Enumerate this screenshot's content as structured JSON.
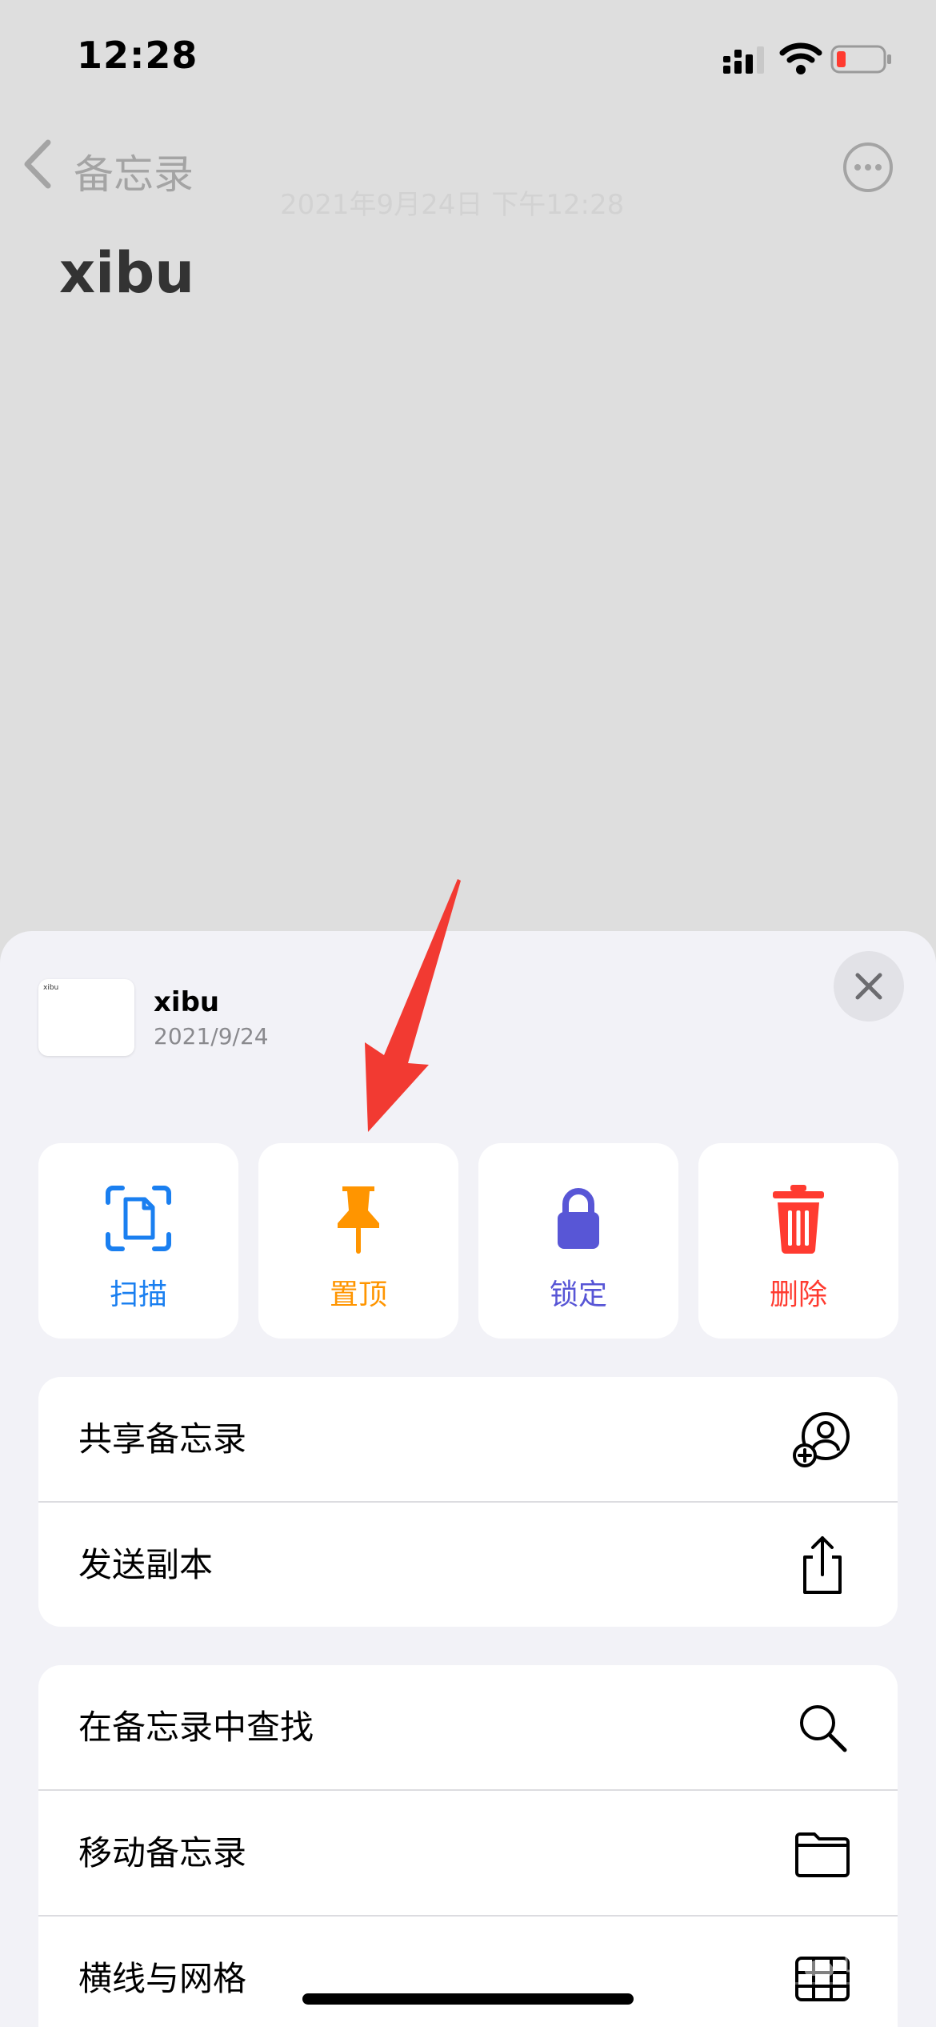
{
  "status_bar": {
    "time": "12:28"
  },
  "nav": {
    "back_label": "备忘录",
    "faded_date": "2021年9月24日 下午12:28"
  },
  "note": {
    "title": "xibu"
  },
  "sheet": {
    "thumb_text": "xibu",
    "title": "xibu",
    "date": "2021/9/24"
  },
  "actions": [
    {
      "label": "扫描",
      "icon": "scan-document-icon",
      "color": "#1a7ff0"
    },
    {
      "label": "置顶",
      "icon": "pin-icon",
      "color": "#ff9500"
    },
    {
      "label": "锁定",
      "icon": "lock-icon",
      "color": "#5856d6"
    },
    {
      "label": "删除",
      "icon": "trash-icon",
      "color": "#ff3b30"
    }
  ],
  "group1": [
    {
      "label": "共享备忘录",
      "icon": "share-person-icon"
    },
    {
      "label": "发送副本",
      "icon": "share-upload-icon"
    }
  ],
  "group2": [
    {
      "label": "在备忘录中查找",
      "icon": "search-icon"
    },
    {
      "label": "移动备忘录",
      "icon": "folder-icon"
    },
    {
      "label": "横线与网格",
      "icon": "grid-icon"
    }
  ],
  "colors": {
    "annotation_arrow": "#f23a32",
    "battery_low": "#ff3b30"
  }
}
